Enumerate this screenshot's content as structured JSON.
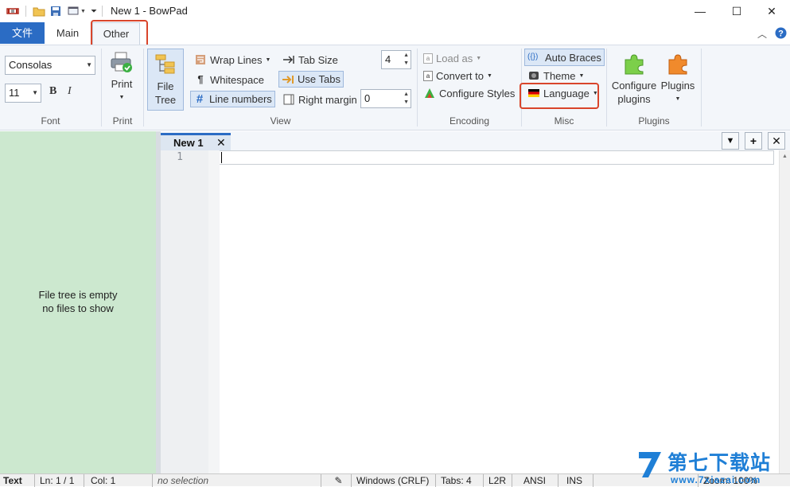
{
  "window": {
    "title": "New 1 - BowPad",
    "minimize_glyph": "—",
    "maximize_glyph": "☐",
    "close_glyph": "✕"
  },
  "ribbon_tabs": {
    "file": "文件",
    "main": "Main",
    "other": "Other"
  },
  "font_group": {
    "label": "Font",
    "font_name": "Consolas",
    "font_size": "11",
    "bold": "B",
    "italic": "I"
  },
  "print_group": {
    "label": "Print",
    "print_button": "Print"
  },
  "view_group": {
    "label": "View",
    "file_tree_line1": "File",
    "file_tree_line2": "Tree",
    "wrap_lines": "Wrap Lines",
    "whitespace": "Whitespace",
    "line_numbers": "Line numbers",
    "tab_size": "Tab Size",
    "tab_size_value": "4",
    "use_tabs": "Use Tabs",
    "right_margin": "Right margin",
    "right_margin_value": "0"
  },
  "encoding_group": {
    "label": "Encoding",
    "load_as": "Load as",
    "convert_to": "Convert to",
    "configure_styles": "Configure Styles"
  },
  "misc_group": {
    "label": "Misc",
    "auto_braces": "Auto Braces",
    "theme": "Theme",
    "language": "Language"
  },
  "plugins_group": {
    "label": "Plugins",
    "configure_line1": "Configure",
    "configure_line2": "plugins",
    "plugins": "Plugins"
  },
  "side_panel": {
    "line1": "File tree is empty",
    "line2": "no files to show"
  },
  "editor": {
    "tab_title": "New 1",
    "line_number": "1",
    "tab_list_glyph": "▼",
    "new_tab_glyph": "+",
    "close_tab_glyph": "✕"
  },
  "status_bar": {
    "lexer": "Text",
    "line": "Ln: 1 / 1",
    "col": "Col: 1",
    "selection": "no selection",
    "eol": "Windows (CRLF)",
    "tabs": "Tabs: 4",
    "direction": "L2R",
    "encoding": "ANSI",
    "mode": "INS",
    "zoom": "Zoom: 100%"
  },
  "watermark": {
    "text": "第七下载站",
    "url": "www.7xiazai.com"
  },
  "colors": {
    "accent": "#2b6cc4",
    "highlight_box": "#d9452b",
    "side_panel": "#cce8cf"
  }
}
